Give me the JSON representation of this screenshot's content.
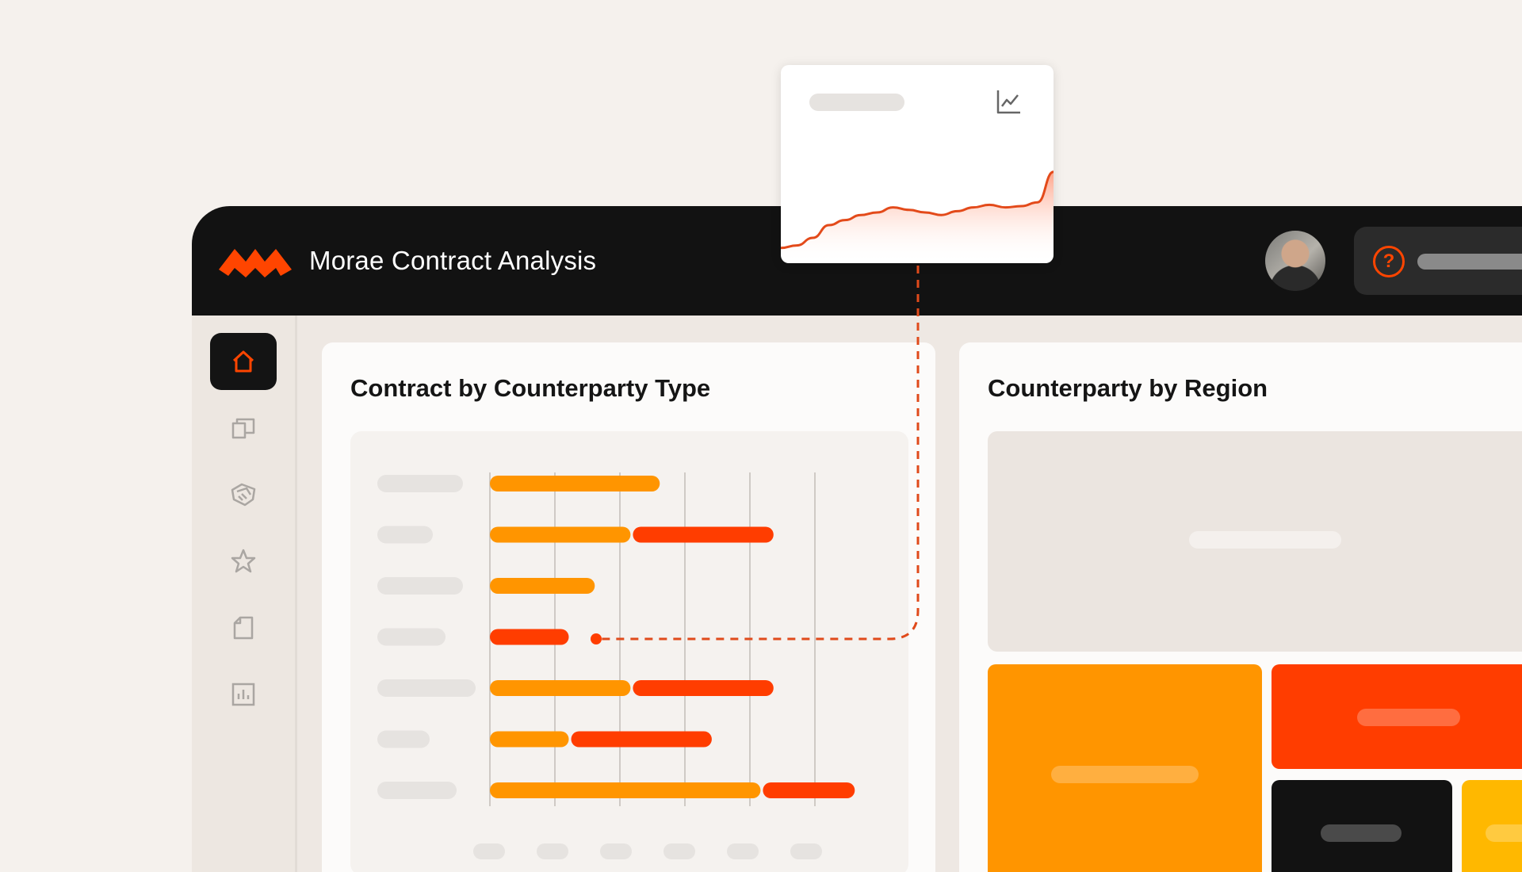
{
  "app": {
    "title": "Morae Contract Analysis"
  },
  "colors": {
    "brand": "#ff4500",
    "orange": "#ff9500",
    "red_orange": "#ff3d00",
    "yellow": "#ffb800",
    "dark": "#121212"
  },
  "header": {
    "avatar": "user-avatar",
    "help_icon": "question-circle-icon",
    "help_icon_glyph": "?"
  },
  "sidebar": {
    "items": [
      {
        "icon": "home-icon",
        "active": true
      },
      {
        "icon": "folders-icon",
        "active": false
      },
      {
        "icon": "handshake-icon",
        "active": false
      },
      {
        "icon": "star-icon",
        "active": false
      },
      {
        "icon": "document-icon",
        "active": false
      },
      {
        "icon": "bar-chart-icon",
        "active": false
      }
    ]
  },
  "cards": {
    "counterparty_type": {
      "title": "Contract by Counterparty Type"
    },
    "counterparty_region": {
      "title": "Counterparty by Region"
    }
  },
  "chart_data": {
    "type": "bar",
    "orientation": "horizontal",
    "stacked": true,
    "categories": [
      "",
      "",
      "",
      "",
      "",
      "",
      ""
    ],
    "series": [
      {
        "color": "#ff9500",
        "values": [
          2.65,
          2.2,
          1.65,
          0,
          2.2,
          1.25,
          4.2
        ]
      },
      {
        "color": "#ff3d00",
        "values": [
          0,
          2.2,
          0,
          1.25,
          2.2,
          2.2,
          1.45
        ]
      }
    ],
    "xlim": [
      0,
      6
    ],
    "grid": true,
    "highlighted_index": 3
  },
  "tooltip": {
    "icon": "line-chart-icon",
    "sparkline": [
      0.12,
      0.14,
      0.2,
      0.3,
      0.34,
      0.38,
      0.4,
      0.44,
      0.42,
      0.4,
      0.38,
      0.41,
      0.44,
      0.46,
      0.44,
      0.45,
      0.48,
      0.72
    ]
  }
}
